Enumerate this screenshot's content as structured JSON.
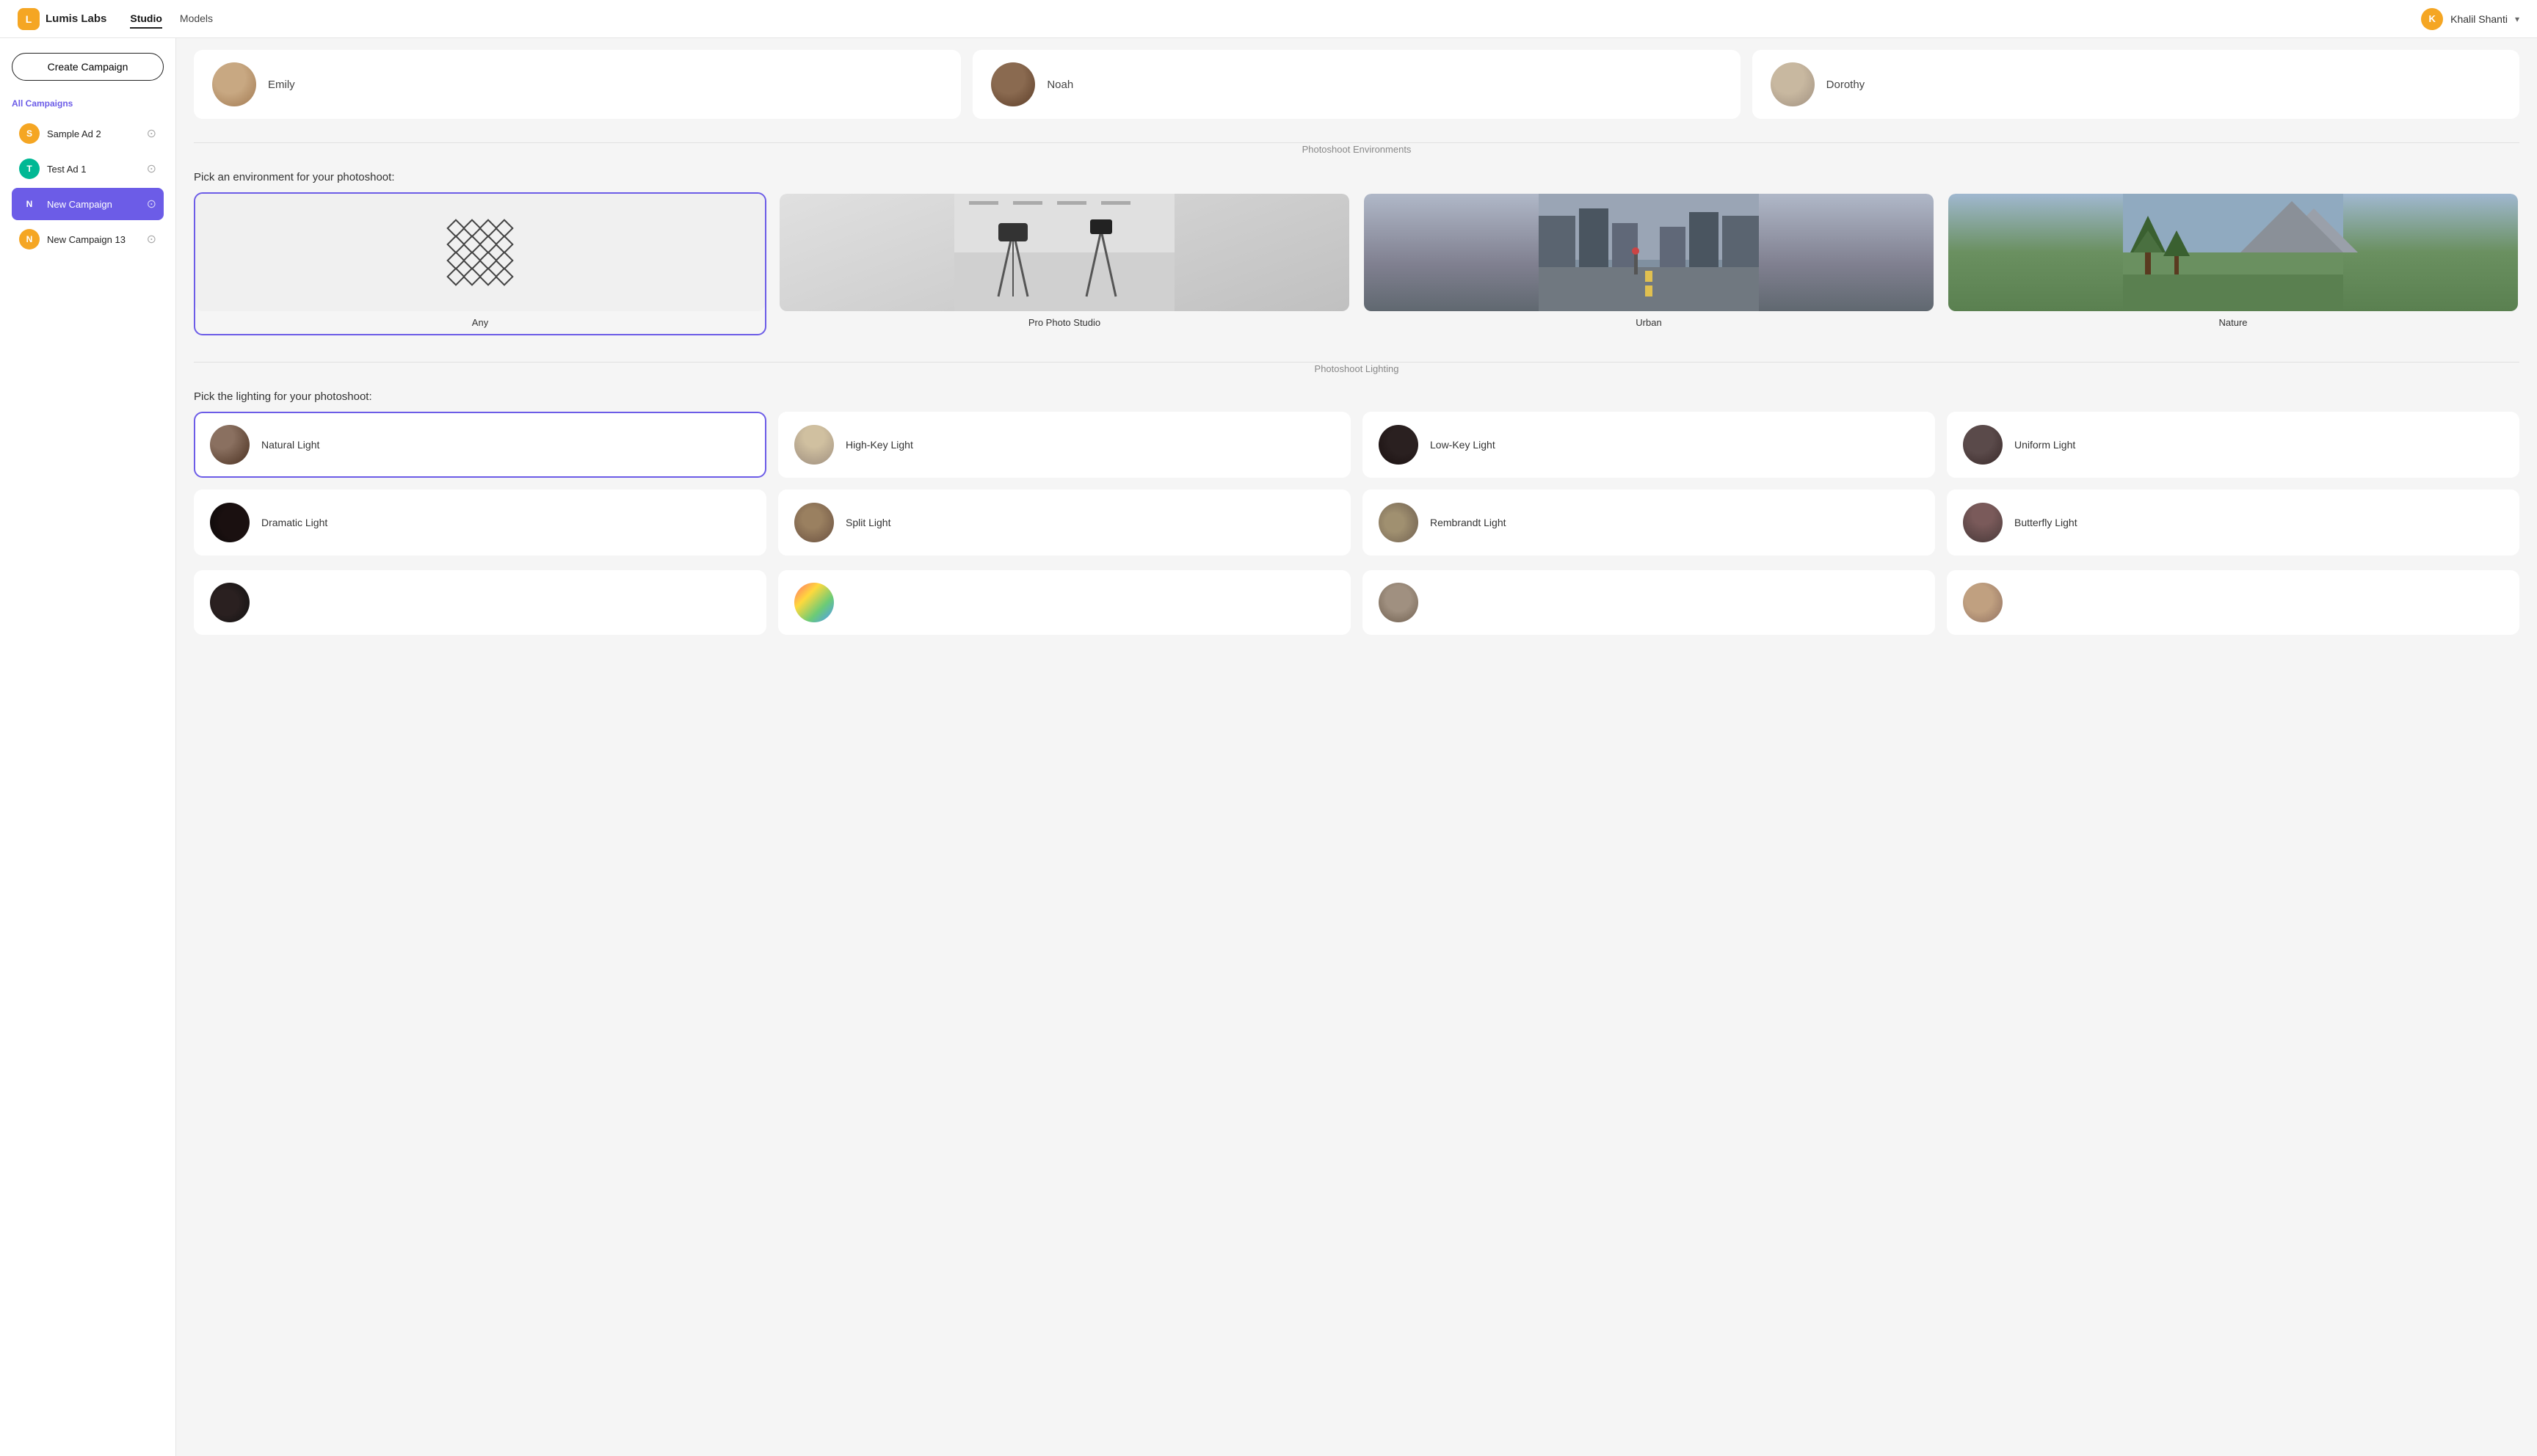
{
  "app": {
    "logo_text": "Lumis Labs",
    "nav": [
      {
        "label": "Studio",
        "active": true
      },
      {
        "label": "Models",
        "active": false
      }
    ],
    "user": {
      "name": "Khalil Shanti",
      "initials": "K"
    }
  },
  "sidebar": {
    "create_button": "Create Campaign",
    "all_campaigns_label": "All Campaigns",
    "campaigns": [
      {
        "name": "Sample Ad 2",
        "initial": "S",
        "color": "orange",
        "active": false
      },
      {
        "name": "Test Ad 1",
        "initial": "T",
        "color": "teal",
        "active": false
      },
      {
        "name": "New Campaign",
        "initial": "N",
        "color": "purple",
        "active": true
      },
      {
        "name": "New Campaign 13",
        "initial": "N",
        "color": "orange",
        "active": false
      }
    ]
  },
  "models": {
    "section_label": "",
    "items": [
      {
        "name": "Emily",
        "avatar_class": "avatar-emily"
      },
      {
        "name": "Noah",
        "avatar_class": "avatar-noah"
      },
      {
        "name": "Dorothy",
        "avatar_class": "avatar-dorothy"
      }
    ]
  },
  "environments": {
    "section_divider": "Photoshoot Environments",
    "section_title": "Pick an environment for your photoshoot:",
    "items": [
      {
        "label": "Any",
        "selected": true,
        "type": "any"
      },
      {
        "label": "Pro Photo Studio",
        "selected": false,
        "type": "studio"
      },
      {
        "label": "Urban",
        "selected": false,
        "type": "urban"
      },
      {
        "label": "Nature",
        "selected": false,
        "type": "nature"
      }
    ]
  },
  "lighting": {
    "section_divider": "Photoshoot Lighting",
    "section_title": "Pick the lighting for your photoshoot:",
    "items": [
      {
        "label": "Natural Light",
        "selected": true,
        "avatar_class": "light-natural"
      },
      {
        "label": "High-Key Light",
        "selected": false,
        "avatar_class": "light-highkey"
      },
      {
        "label": "Low-Key Light",
        "selected": false,
        "avatar_class": "light-lowkey"
      },
      {
        "label": "Uniform Light",
        "selected": false,
        "avatar_class": "light-uniform"
      },
      {
        "label": "Dramatic Light",
        "selected": false,
        "avatar_class": "light-dramatic"
      },
      {
        "label": "Split Light",
        "selected": false,
        "avatar_class": "light-split"
      },
      {
        "label": "Rembrandt Light",
        "selected": false,
        "avatar_class": "light-rembrandt"
      },
      {
        "label": "Butterfly Light",
        "selected": false,
        "avatar_class": "light-butterfly"
      }
    ],
    "bottom_row": [
      {
        "avatar_class": "partial-dark"
      },
      {
        "avatar_class": "partial-colorful"
      },
      {
        "avatar_class": "partial-medium"
      },
      {
        "avatar_class": "partial-warm"
      }
    ]
  }
}
